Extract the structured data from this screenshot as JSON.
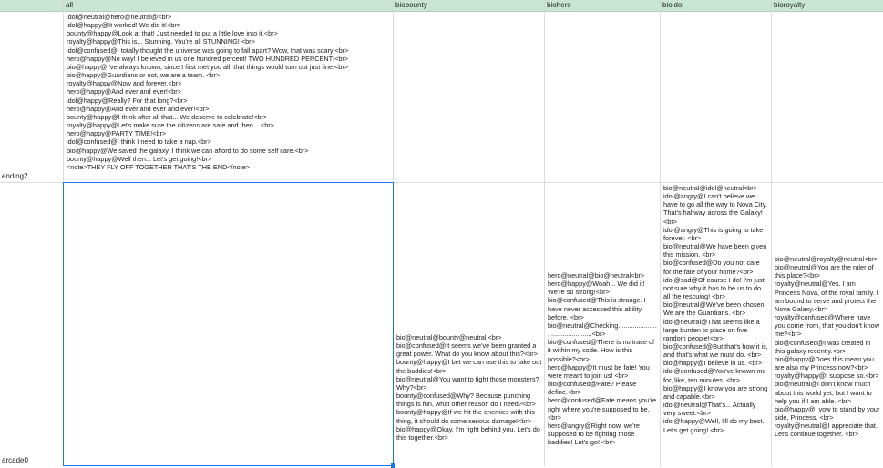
{
  "columns": [
    "all",
    "biobounty",
    "biohero",
    "bioidol",
    "bioroyalty"
  ],
  "rows": [
    {
      "label": "ending2"
    },
    {
      "label": "arcade0"
    }
  ],
  "cells": {
    "ending2_all": [
      "idol@neutral@hero@neutral@<br>",
      "idol@happy@It worked! We did it!<br>",
      "bounty@happy@Look at that! Just needed to put a little love into it.<br>",
      "royalty@happy@This is... Stunning. You're all STUNNING! <br>",
      "idol@confused@I totally thought the universe was going to fall apart? Wow, that was scary!<br>",
      "hero@happy@No way! I believed in us one hundred percent! TWO HUNDRED PERCENT!<br>",
      "bio@happy@I've always known, since I first met you all, that things would turn out just fine.<br>",
      "bio@happy@Guardians or not, we are a team. <br>",
      "royalty@happy@Now and forever.<br>",
      "hero@happy@And ever and ever!<br>",
      "idol@happy@Really? For that long?<br>",
      "hero@happy@And ever and ever and ever!<br>",
      "bounty@happy@I think after all that... We deserve to celebrate!<br>",
      "royalty@happy@Let's make sure the citizens are safe and then... <br>",
      "hero@happy@PARTY TIME!<br>",
      "idol@confused@I think I need to take a nap.<br>",
      "bio@happy@We saved the galaxy. I think we can afford to do some self care.<br>",
      "bounty@happy@Well then... Let's get going!<br>",
      "<note>THEY FLY OFF TOGETHER THAT'S THE END</note>"
    ],
    "arcade0_biobounty": [
      "bio@neutral@bounty@neutral <br>",
      "bio@confused@It seems we've been granted a great power. What do you know about this?<br>",
      "bounty@happy@I bet we can use this to take out the baddies!<br>",
      "bio@neutral@You want to fight those monsters? Why?<br>",
      "bounty@confused@Why? Because punching things is fun, what other reason do I need?<br>",
      "bounty@happy@If we hit the enemies with this thing, it should do some serious damage!<br>",
      "bio@happy@Okay, I'm right behind you. Let's do this together.<br>"
    ],
    "arcade0_biohero": [
      "hero@neutral@bio@neutral<br>",
      "hero@happy@Woah... We did it! We're so strong!<br>",
      "bio@confused@This is strange. I have never accessed this ability before. <br>",
      "bio@neutral@Checking...................... ......................<br>",
      "bio@confused@There is no trace of it within my code. How is this possible?<br>",
      "hero@happy@It must be fate! You were meant to join us! <br>",
      "bio@confused@Fate? Please define.<br>",
      "hero@confused@Fate means you're right where you're supposed to be.<br>",
      "hero@angry@Right now, we're supposed to be fighting those baddies! Let's go! <br>"
    ],
    "arcade0_bioidol": [
      "bio@neutral@idol@neutral<br>",
      "idol@angry@I can't believe we have to go all the way to Nova City. That's halfway across the Galaxy! <br>",
      "idol@angry@This is going to take forever. <br>",
      "bio@neutral@We have been given this mission. <br>",
      "bio@confused@Do you not care for the fate of your home?<br>",
      "idol@sad@Of course I do! I'm just not sure why it has to be us to do all the rescuing! <br>",
      "bio@neutral@We've been chosen. We are the Guardians. <br>",
      "idol@neutral@That seems like a large burden to place on five random people!<br>",
      "bio@confused@But that's how it is, and that's what we must do. <br>",
      "bio@happy@I believe in us. <br>",
      "idol@confused@You've known me for, like, ten minutes. <br>",
      "bio@happy@I know you are strong and capable.<br>",
      "idol@neutral@That's... Actually very sweet.<br>",
      "idol@happy@Well, I'll do my best. Let's get going! <br>"
    ],
    "arcade0_bioroyalty": [
      "bio@neutral@royalty@neutral<br>",
      "bio@neutral@You are the ruler of this place?<br>",
      "royalty@neutral@Yes. I am Princess Nova, of the royal family. I am bound to serve and protect the Nova Galaxy.<br>",
      "royalty@confused@Where have you come from, that you don't know me?<br>",
      "bio@confused@I was created in this galaxy recently.<br>",
      "bio@happy@Does this mean you are also my Princess now?<br>",
      "royalty@happy@I suppose so.<br>",
      "bio@neutral@I don't know much about this world yet, but I want to help you if I am able. <br>",
      "bio@happy@I vow to stand by your side, Princess. <br>",
      "royalty@neutral@I appreciate that. Let's continue together. <br>"
    ]
  }
}
